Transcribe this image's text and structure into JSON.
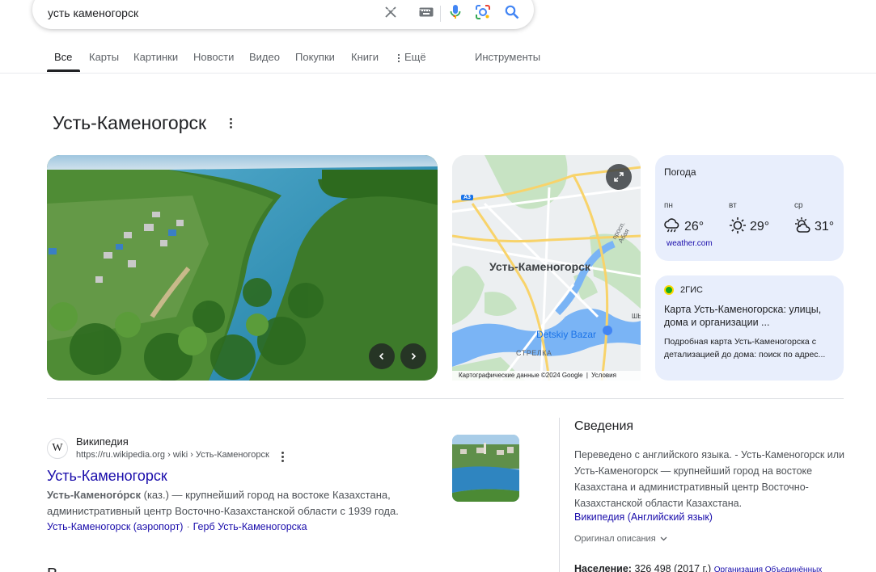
{
  "search": {
    "query": "усть каменогорск"
  },
  "tabs": [
    {
      "label": "Все"
    },
    {
      "label": "Карты"
    },
    {
      "label": "Картинки"
    },
    {
      "label": "Новости"
    },
    {
      "label": "Видео"
    },
    {
      "label": "Покупки"
    },
    {
      "label": "Книги"
    },
    {
      "label": "Ещё"
    },
    {
      "label": "Инструменты"
    }
  ],
  "entity": {
    "title": "Усть-Каменогорск"
  },
  "map": {
    "city_label": "Усть-Каменогорск",
    "poi_label": "Detskiy Bazar",
    "district_label": "СТРЕЛКА",
    "road_label": "просп. Абая",
    "route_badge": "A3",
    "district_badge": "ШЫ",
    "attribution": "Картографические данные ©2024 Google",
    "terms": "Условия"
  },
  "weather": {
    "title": "Погода",
    "days": [
      {
        "day": "пн",
        "temp": "26°",
        "icon": "rain-cloud-icon"
      },
      {
        "day": "вт",
        "temp": "29°",
        "icon": "sun-icon"
      },
      {
        "day": "ср",
        "temp": "31°",
        "icon": "partly-sunny-icon"
      }
    ],
    "source": "weather.com"
  },
  "gis": {
    "name": "2ГИС",
    "title": "Карта Усть-Каменогорска: улицы, дома и организации ...",
    "desc": "Подробная карта Усть-Каменогорска с детализацией до дома: поиск по адрес..."
  },
  "result": {
    "favicon": "W",
    "site_name": "Википедия",
    "url": "https://ru.wikipedia.org › wiki › Усть-Каменогорск",
    "title": "Усть-Каменогорск",
    "snippet_bold": "Усть-Каменого́рск",
    "snippet_rest": " (каз.) — крупнейший город на востоке Казахстана, административный центр Восточно-Казахстанской области с 1939 года.",
    "sitelinks": [
      "Усть-Каменогорск (аэропорт)",
      "Герб Усть-Каменогорска"
    ],
    "sep": "·"
  },
  "next_heading": "В",
  "info": {
    "heading": "Сведения",
    "description": "Переведено с английского языка. - Усть-Каменогорск или Усть-Каменогорск — крупнейший город на востоке Казахстана и административный центр Восточно-Казахстанской области Казахстана.",
    "wiki_link": "Википедия (Английский язык)",
    "original": "Оригинал описания",
    "population_label": "Население:",
    "population_value": " 326 498 (2017 г.) ",
    "population_source": "Организация Объединённых"
  },
  "colors": {
    "link": "#1a0dab",
    "card": "#e8eefc",
    "accent_blue": "#1a73e8"
  }
}
